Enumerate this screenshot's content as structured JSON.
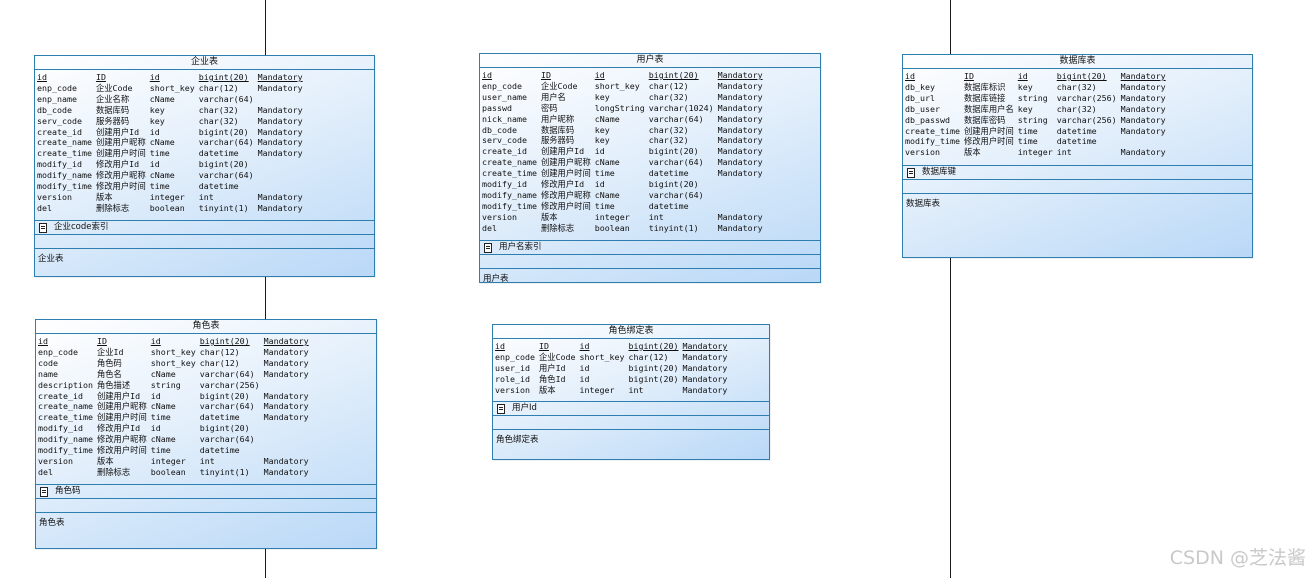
{
  "watermark": "CSDN @芝法酱",
  "entities": {
    "enterprise": {
      "title": "企业表",
      "columns": [
        [
          "id",
          "ID",
          "id",
          "bigint(20)",
          "Mandatory"
        ],
        [
          "enp_code",
          "企业Code",
          "short_key",
          "char(12)",
          "Mandatory"
        ],
        [
          "enp_name",
          "企业名称",
          "cName",
          "varchar(64)",
          ""
        ],
        [
          "db_code",
          "数据库码",
          "key",
          "char(32)",
          "Mandatory"
        ],
        [
          "serv_code",
          "服务器码",
          "key",
          "char(32)",
          "Mandatory"
        ],
        [
          "create_id",
          "创建用户Id",
          "id",
          "bigint(20)",
          "Mandatory"
        ],
        [
          "create_name",
          "创建用户昵称",
          "cName",
          "varchar(64)",
          "Mandatory"
        ],
        [
          "create_time",
          "创建用户时间",
          "time",
          "datetime",
          "Mandatory"
        ],
        [
          "modify_id",
          "修改用户Id",
          "id",
          "bigint(20)",
          ""
        ],
        [
          "modify_name",
          "修改用户昵称",
          "cName",
          "varchar(64)",
          ""
        ],
        [
          "modify_time",
          "修改用户时间",
          "time",
          "datetime",
          ""
        ],
        [
          "version",
          "版本",
          "integer",
          "int",
          "Mandatory"
        ],
        [
          "del",
          "删除标志",
          "boolean",
          "tinyint(1)",
          "Mandatory"
        ]
      ],
      "index": "企业code索引",
      "comment": "企业表"
    },
    "user": {
      "title": "用户表",
      "columns": [
        [
          "id",
          "ID",
          "id",
          "bigint(20)",
          "Mandatory"
        ],
        [
          "enp_code",
          "企业Code",
          "short_key",
          "char(12)",
          "Mandatory"
        ],
        [
          "user_name",
          "用户名",
          "key",
          "char(32)",
          "Mandatory"
        ],
        [
          "passwd",
          "密码",
          "longString",
          "varchar(1024)",
          "Mandatory"
        ],
        [
          "nick_name",
          "用户昵称",
          "cName",
          "varchar(64)",
          "Mandatory"
        ],
        [
          "db_code",
          "数据库码",
          "key",
          "char(32)",
          "Mandatory"
        ],
        [
          "serv_code",
          "服务器码",
          "key",
          "char(32)",
          "Mandatory"
        ],
        [
          "create_id",
          "创建用户Id",
          "id",
          "bigint(20)",
          "Mandatory"
        ],
        [
          "create_name",
          "创建用户昵称",
          "cName",
          "varchar(64)",
          "Mandatory"
        ],
        [
          "create_time",
          "创建用户时间",
          "time",
          "datetime",
          "Mandatory"
        ],
        [
          "modify_id",
          "修改用户Id",
          "id",
          "bigint(20)",
          ""
        ],
        [
          "modify_name",
          "修改用户昵称",
          "cName",
          "varchar(64)",
          ""
        ],
        [
          "modify_time",
          "修改用户时间",
          "time",
          "datetime",
          ""
        ],
        [
          "version",
          "版本",
          "integer",
          "int",
          "Mandatory"
        ],
        [
          "del",
          "删除标志",
          "boolean",
          "tinyint(1)",
          "Mandatory"
        ]
      ],
      "index": "用户名索引",
      "comment": "用户表"
    },
    "database": {
      "title": "数据库表",
      "columns": [
        [
          "id",
          "ID",
          "id",
          "bigint(20)",
          "Mandatory"
        ],
        [
          "db_key",
          "数据库标识",
          "key",
          "char(32)",
          "Mandatory"
        ],
        [
          "db_url",
          "数据库链接",
          "string",
          "varchar(256)",
          "Mandatory"
        ],
        [
          "db_user",
          "数据库用户名",
          "key",
          "char(32)",
          "Mandatory"
        ],
        [
          "db_passwd",
          "数据库密码",
          "string",
          "varchar(256)",
          "Mandatory"
        ],
        [
          "create_time",
          "创建用户时间",
          "time",
          "datetime",
          "Mandatory"
        ],
        [
          "modify_time",
          "修改用户时间",
          "time",
          "datetime",
          ""
        ],
        [
          "version",
          "版本",
          "integer",
          "int",
          "Mandatory"
        ]
      ],
      "index": "数据库键",
      "comment": "数据库表"
    },
    "role": {
      "title": "角色表",
      "columns": [
        [
          "id",
          "ID",
          "id",
          "bigint(20)",
          "Mandatory"
        ],
        [
          "enp_code",
          "企业Id",
          "short_key",
          "char(12)",
          "Mandatory"
        ],
        [
          "code",
          "角色码",
          "short_key",
          "char(12)",
          "Mandatory"
        ],
        [
          "name",
          "角色名",
          "cName",
          "varchar(64)",
          "Mandatory"
        ],
        [
          "description",
          "角色描述",
          "string",
          "varchar(256)",
          ""
        ],
        [
          "create_id",
          "创建用户Id",
          "id",
          "bigint(20)",
          "Mandatory"
        ],
        [
          "create_name",
          "创建用户昵称",
          "cName",
          "varchar(64)",
          "Mandatory"
        ],
        [
          "create_time",
          "创建用户时间",
          "time",
          "datetime",
          "Mandatory"
        ],
        [
          "modify_id",
          "修改用户Id",
          "id",
          "bigint(20)",
          ""
        ],
        [
          "modify_name",
          "修改用户昵称",
          "cName",
          "varchar(64)",
          ""
        ],
        [
          "modify_time",
          "修改用户时间",
          "time",
          "datetime",
          ""
        ],
        [
          "version",
          "版本",
          "integer",
          "int",
          "Mandatory"
        ],
        [
          "del",
          "删除标志",
          "boolean",
          "tinyint(1)",
          "Mandatory"
        ]
      ],
      "index": "角色码",
      "comment": "角色表"
    },
    "role_binding": {
      "title": "角色绑定表",
      "columns": [
        [
          "id",
          "ID",
          "id",
          "bigint(20)",
          "Mandatory"
        ],
        [
          "enp_code",
          "企业Code",
          "short_key",
          "char(12)",
          "Mandatory"
        ],
        [
          "user_id",
          "用户Id",
          "id",
          "bigint(20)",
          "Mandatory"
        ],
        [
          "role_id",
          "角色Id",
          "id",
          "bigint(20)",
          "Mandatory"
        ],
        [
          "version",
          "版本",
          "integer",
          "int",
          "Mandatory"
        ]
      ],
      "index": "用户Id",
      "comment": "角色绑定表"
    }
  }
}
